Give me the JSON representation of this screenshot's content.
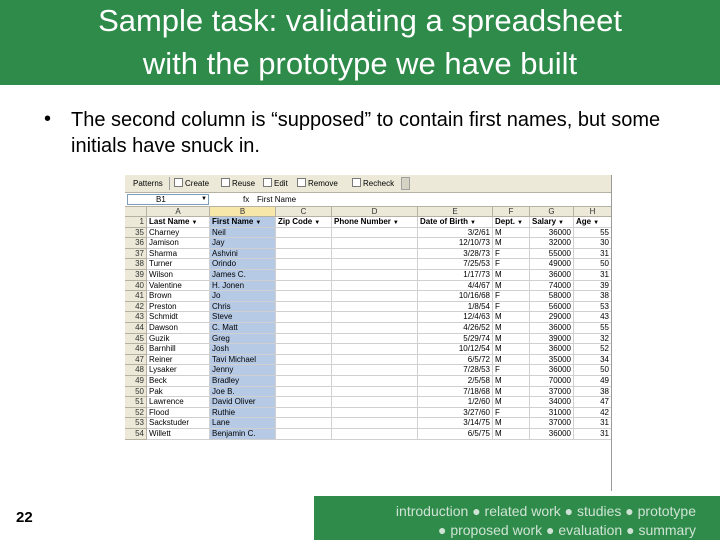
{
  "slide": {
    "title_line1": "Sample task: validating a spreadsheet",
    "title_line2": "with the prototype we have built",
    "bullet_mark": "•",
    "bullet_text": "The second column is “supposed” to contain first names, but some initials have snuck in.",
    "page_number": "22",
    "footer_line1": "introduction ● related work ● studies ● prototype",
    "footer_line2": "● proposed work ● evaluation ● summary"
  },
  "spreadsheet": {
    "toolbar": {
      "patterns": "Patterns",
      "create": "Create",
      "reuse": "Reuse",
      "edit": "Edit",
      "remove": "Remove",
      "recheck": "Recheck"
    },
    "name_box": "B1",
    "fx": "fx",
    "formula_value": "First Name",
    "col_letters": [
      "A",
      "B",
      "C",
      "D",
      "E",
      "F",
      "G",
      "H"
    ],
    "headers": [
      "Last Name",
      "First Name",
      "Zip Code",
      "Phone Number",
      "Date of Birth",
      "Dept.",
      "Salary",
      "Age"
    ],
    "rows": [
      {
        "n": "35",
        "last": "Charney",
        "first": "Neil",
        "dob": "3/2/61",
        "dept": "M",
        "salary": "36000",
        "age": "55"
      },
      {
        "n": "36",
        "last": "Jamison",
        "first": "Jay",
        "dob": "12/10/73",
        "dept": "M",
        "salary": "32000",
        "age": "30"
      },
      {
        "n": "37",
        "last": "Sharma",
        "first": "Ashvini",
        "dob": "3/28/73",
        "dept": "F",
        "salary": "55000",
        "age": "31"
      },
      {
        "n": "38",
        "last": "Turner",
        "first": "Orindo",
        "dob": "7/25/53",
        "dept": "F",
        "salary": "49000",
        "age": "50"
      },
      {
        "n": "39",
        "last": "Wilson",
        "first": "James C.",
        "dob": "1/17/73",
        "dept": "M",
        "salary": "36000",
        "age": "31"
      },
      {
        "n": "40",
        "last": "Valentine",
        "first": "H. Jonen",
        "dob": "4/4/67",
        "dept": "M",
        "salary": "74000",
        "age": "39"
      },
      {
        "n": "41",
        "last": "Brown",
        "first": "Jo",
        "dob": "10/16/68",
        "dept": "F",
        "salary": "58000",
        "age": "38"
      },
      {
        "n": "42",
        "last": "Preston",
        "first": "Chris",
        "dob": "1/8/54",
        "dept": "F",
        "salary": "56000",
        "age": "53"
      },
      {
        "n": "43",
        "last": "Schmidt",
        "first": "Steve",
        "dob": "12/4/63",
        "dept": "M",
        "salary": "29000",
        "age": "43"
      },
      {
        "n": "44",
        "last": "Dawson",
        "first": "C. Matt",
        "dob": "4/26/52",
        "dept": "M",
        "salary": "36000",
        "age": "55"
      },
      {
        "n": "45",
        "last": "Guzik",
        "first": "Greg",
        "dob": "5/29/74",
        "dept": "M",
        "salary": "39000",
        "age": "32"
      },
      {
        "n": "46",
        "last": "Barnhill",
        "first": "Josh",
        "dob": "10/12/54",
        "dept": "M",
        "salary": "36000",
        "age": "52"
      },
      {
        "n": "47",
        "last": "Reiner",
        "first": "Tavi Michael",
        "dob": "6/5/72",
        "dept": "M",
        "salary": "35000",
        "age": "34"
      },
      {
        "n": "48",
        "last": "Lysaker",
        "first": "Jenny",
        "dob": "7/28/53",
        "dept": "F",
        "salary": "36000",
        "age": "50"
      },
      {
        "n": "49",
        "last": "Beck",
        "first": "Bradley",
        "dob": "2/5/58",
        "dept": "M",
        "salary": "70000",
        "age": "49"
      },
      {
        "n": "50",
        "last": "Pak",
        "first": "Joe B.",
        "dob": "7/18/68",
        "dept": "M",
        "salary": "37000",
        "age": "38"
      },
      {
        "n": "51",
        "last": "Lawrence",
        "first": "David Oliver",
        "dob": "1/2/60",
        "dept": "M",
        "salary": "34000",
        "age": "47"
      },
      {
        "n": "52",
        "last": "Flood",
        "first": "Ruthie",
        "dob": "3/27/60",
        "dept": "F",
        "salary": "31000",
        "age": "42"
      },
      {
        "n": "53",
        "last": "Sackstuder",
        "first": "Lane",
        "dob": "3/14/75",
        "dept": "M",
        "salary": "37000",
        "age": "31"
      },
      {
        "n": "54",
        "last": "Willett",
        "first": "Benjamin C.",
        "dob": "6/5/75",
        "dept": "M",
        "salary": "36000",
        "age": "31"
      }
    ]
  },
  "colors": {
    "theme_green": "#2e8b4a",
    "selected_column": "#b6cae6",
    "footer_text": "#cfe3d4"
  }
}
